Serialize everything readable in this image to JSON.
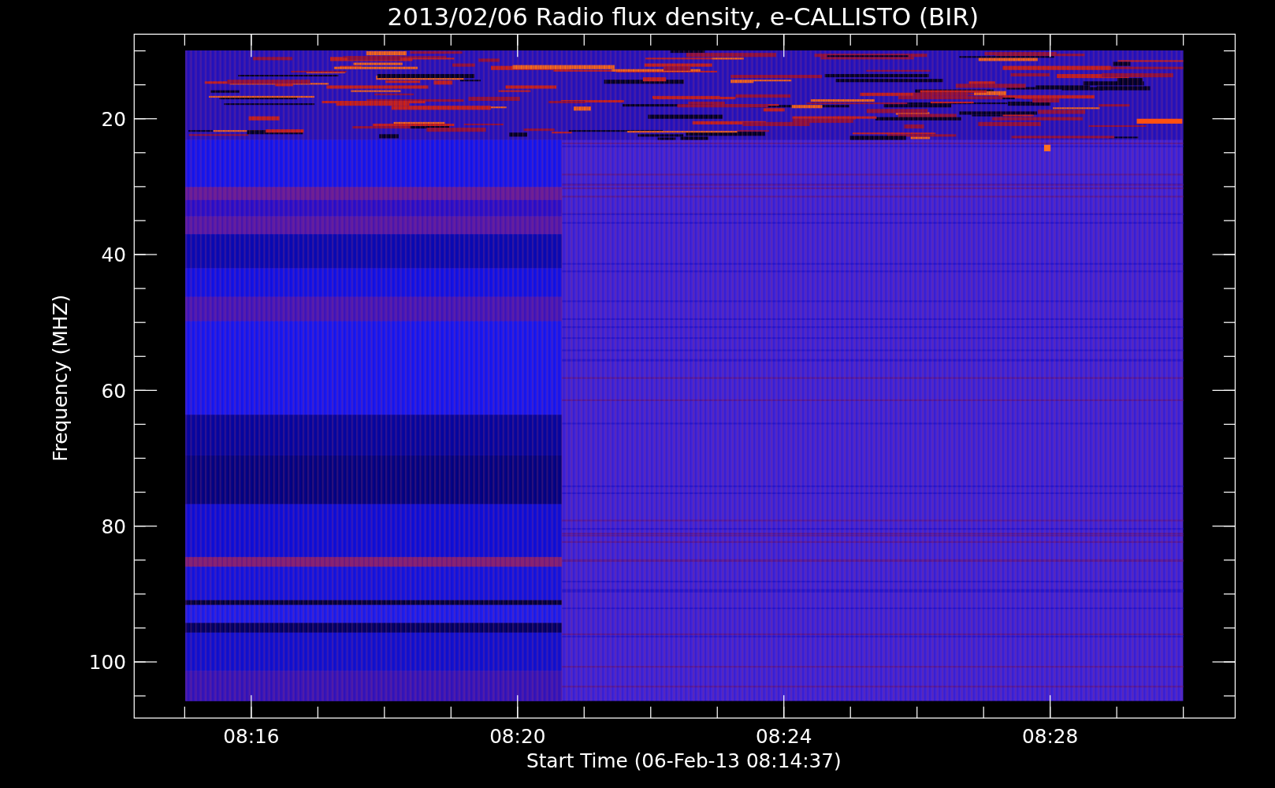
{
  "title": "2013/02/06  Radio flux density, e-CALLISTO (BIR)",
  "ylabel": "Frequency (MHZ)",
  "xlabel": "Start Time (06-Feb-13 08:14:37)",
  "y_ticks": [
    "20",
    "40",
    "60",
    "80",
    "100"
  ],
  "x_ticks": [
    "08:16",
    "08:20",
    "08:24",
    "08:28"
  ]
}
